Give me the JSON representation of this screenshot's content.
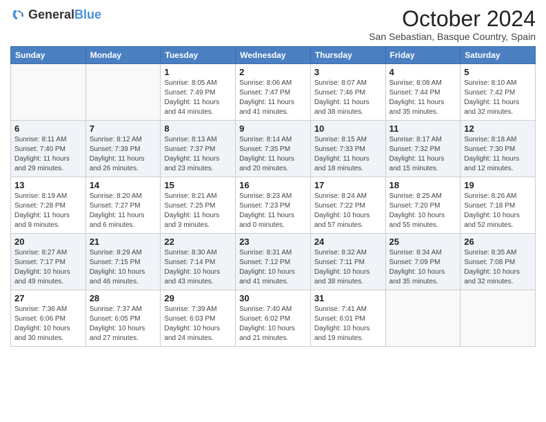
{
  "logo": {
    "general": "General",
    "blue": "Blue"
  },
  "title": "October 2024",
  "location": "San Sebastian, Basque Country, Spain",
  "days_of_week": [
    "Sunday",
    "Monday",
    "Tuesday",
    "Wednesday",
    "Thursday",
    "Friday",
    "Saturday"
  ],
  "weeks": [
    [
      {
        "day": "",
        "sunrise": "",
        "sunset": "",
        "daylight": ""
      },
      {
        "day": "",
        "sunrise": "",
        "sunset": "",
        "daylight": ""
      },
      {
        "day": "1",
        "sunrise": "Sunrise: 8:05 AM",
        "sunset": "Sunset: 7:49 PM",
        "daylight": "Daylight: 11 hours and 44 minutes."
      },
      {
        "day": "2",
        "sunrise": "Sunrise: 8:06 AM",
        "sunset": "Sunset: 7:47 PM",
        "daylight": "Daylight: 11 hours and 41 minutes."
      },
      {
        "day": "3",
        "sunrise": "Sunrise: 8:07 AM",
        "sunset": "Sunset: 7:46 PM",
        "daylight": "Daylight: 11 hours and 38 minutes."
      },
      {
        "day": "4",
        "sunrise": "Sunrise: 8:08 AM",
        "sunset": "Sunset: 7:44 PM",
        "daylight": "Daylight: 11 hours and 35 minutes."
      },
      {
        "day": "5",
        "sunrise": "Sunrise: 8:10 AM",
        "sunset": "Sunset: 7:42 PM",
        "daylight": "Daylight: 11 hours and 32 minutes."
      }
    ],
    [
      {
        "day": "6",
        "sunrise": "Sunrise: 8:11 AM",
        "sunset": "Sunset: 7:40 PM",
        "daylight": "Daylight: 11 hours and 29 minutes."
      },
      {
        "day": "7",
        "sunrise": "Sunrise: 8:12 AM",
        "sunset": "Sunset: 7:39 PM",
        "daylight": "Daylight: 11 hours and 26 minutes."
      },
      {
        "day": "8",
        "sunrise": "Sunrise: 8:13 AM",
        "sunset": "Sunset: 7:37 PM",
        "daylight": "Daylight: 11 hours and 23 minutes."
      },
      {
        "day": "9",
        "sunrise": "Sunrise: 8:14 AM",
        "sunset": "Sunset: 7:35 PM",
        "daylight": "Daylight: 11 hours and 20 minutes."
      },
      {
        "day": "10",
        "sunrise": "Sunrise: 8:15 AM",
        "sunset": "Sunset: 7:33 PM",
        "daylight": "Daylight: 11 hours and 18 minutes."
      },
      {
        "day": "11",
        "sunrise": "Sunrise: 8:17 AM",
        "sunset": "Sunset: 7:32 PM",
        "daylight": "Daylight: 11 hours and 15 minutes."
      },
      {
        "day": "12",
        "sunrise": "Sunrise: 8:18 AM",
        "sunset": "Sunset: 7:30 PM",
        "daylight": "Daylight: 11 hours and 12 minutes."
      }
    ],
    [
      {
        "day": "13",
        "sunrise": "Sunrise: 8:19 AM",
        "sunset": "Sunset: 7:28 PM",
        "daylight": "Daylight: 11 hours and 9 minutes."
      },
      {
        "day": "14",
        "sunrise": "Sunrise: 8:20 AM",
        "sunset": "Sunset: 7:27 PM",
        "daylight": "Daylight: 11 hours and 6 minutes."
      },
      {
        "day": "15",
        "sunrise": "Sunrise: 8:21 AM",
        "sunset": "Sunset: 7:25 PM",
        "daylight": "Daylight: 11 hours and 3 minutes."
      },
      {
        "day": "16",
        "sunrise": "Sunrise: 8:23 AM",
        "sunset": "Sunset: 7:23 PM",
        "daylight": "Daylight: 11 hours and 0 minutes."
      },
      {
        "day": "17",
        "sunrise": "Sunrise: 8:24 AM",
        "sunset": "Sunset: 7:22 PM",
        "daylight": "Daylight: 10 hours and 57 minutes."
      },
      {
        "day": "18",
        "sunrise": "Sunrise: 8:25 AM",
        "sunset": "Sunset: 7:20 PM",
        "daylight": "Daylight: 10 hours and 55 minutes."
      },
      {
        "day": "19",
        "sunrise": "Sunrise: 8:26 AM",
        "sunset": "Sunset: 7:18 PM",
        "daylight": "Daylight: 10 hours and 52 minutes."
      }
    ],
    [
      {
        "day": "20",
        "sunrise": "Sunrise: 8:27 AM",
        "sunset": "Sunset: 7:17 PM",
        "daylight": "Daylight: 10 hours and 49 minutes."
      },
      {
        "day": "21",
        "sunrise": "Sunrise: 8:29 AM",
        "sunset": "Sunset: 7:15 PM",
        "daylight": "Daylight: 10 hours and 46 minutes."
      },
      {
        "day": "22",
        "sunrise": "Sunrise: 8:30 AM",
        "sunset": "Sunset: 7:14 PM",
        "daylight": "Daylight: 10 hours and 43 minutes."
      },
      {
        "day": "23",
        "sunrise": "Sunrise: 8:31 AM",
        "sunset": "Sunset: 7:12 PM",
        "daylight": "Daylight: 10 hours and 41 minutes."
      },
      {
        "day": "24",
        "sunrise": "Sunrise: 8:32 AM",
        "sunset": "Sunset: 7:11 PM",
        "daylight": "Daylight: 10 hours and 38 minutes."
      },
      {
        "day": "25",
        "sunrise": "Sunrise: 8:34 AM",
        "sunset": "Sunset: 7:09 PM",
        "daylight": "Daylight: 10 hours and 35 minutes."
      },
      {
        "day": "26",
        "sunrise": "Sunrise: 8:35 AM",
        "sunset": "Sunset: 7:08 PM",
        "daylight": "Daylight: 10 hours and 32 minutes."
      }
    ],
    [
      {
        "day": "27",
        "sunrise": "Sunrise: 7:36 AM",
        "sunset": "Sunset: 6:06 PM",
        "daylight": "Daylight: 10 hours and 30 minutes."
      },
      {
        "day": "28",
        "sunrise": "Sunrise: 7:37 AM",
        "sunset": "Sunset: 6:05 PM",
        "daylight": "Daylight: 10 hours and 27 minutes."
      },
      {
        "day": "29",
        "sunrise": "Sunrise: 7:39 AM",
        "sunset": "Sunset: 6:03 PM",
        "daylight": "Daylight: 10 hours and 24 minutes."
      },
      {
        "day": "30",
        "sunrise": "Sunrise: 7:40 AM",
        "sunset": "Sunset: 6:02 PM",
        "daylight": "Daylight: 10 hours and 21 minutes."
      },
      {
        "day": "31",
        "sunrise": "Sunrise: 7:41 AM",
        "sunset": "Sunset: 6:01 PM",
        "daylight": "Daylight: 10 hours and 19 minutes."
      },
      {
        "day": "",
        "sunrise": "",
        "sunset": "",
        "daylight": ""
      },
      {
        "day": "",
        "sunrise": "",
        "sunset": "",
        "daylight": ""
      }
    ]
  ]
}
